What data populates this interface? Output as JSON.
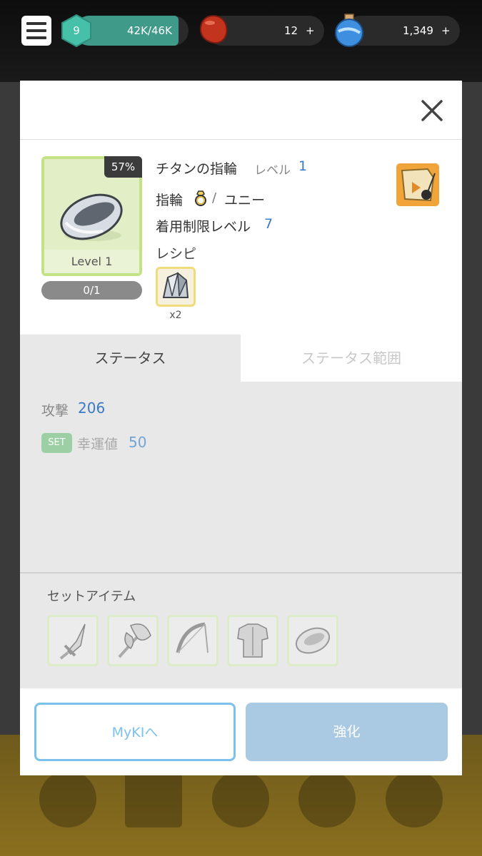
{
  "hud": {
    "player_level": "9",
    "exp": "42K/46K",
    "exp_fraction": 0.91,
    "beans": "12",
    "beans_plus": "+",
    "potion": "1,349",
    "potion_plus": "+"
  },
  "item": {
    "name": "チタンの指輪",
    "level_label": "レベル",
    "level_value": "1",
    "type": "指輪",
    "slash": "/",
    "rarity": "ユニー",
    "req_label": "着用制限レベル",
    "req_value": "7",
    "percent": "57%",
    "card_level": "Level 1",
    "count": "0/1",
    "recipe_label": "レシピ",
    "recipe_qty": "x2"
  },
  "tabs": [
    "ステータス",
    "ステータス範囲"
  ],
  "stats": {
    "attack_label": "攻撃",
    "attack_value": "206",
    "set_badge": "SET",
    "luck_label": "幸運値",
    "luck_value": "50"
  },
  "set_items": {
    "title": "セットアイテム",
    "icons": [
      "sword-icon",
      "axe-icon",
      "bow-icon",
      "armor-icon",
      "ring-icon"
    ]
  },
  "buttons": {
    "myki": "MyKIへ",
    "enhance": "強化"
  },
  "colors": {
    "accent_blue": "#3b7bc4",
    "frame_green": "#c3e286",
    "exp_teal": "#3f9a8a"
  }
}
